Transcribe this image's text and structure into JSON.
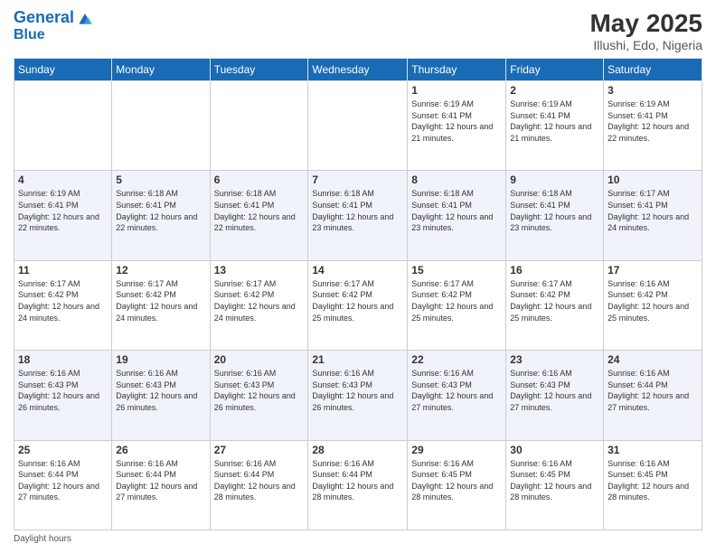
{
  "logo": {
    "line1": "General",
    "line2": "Blue"
  },
  "title": "May 2025",
  "subtitle": "Illushi, Edo, Nigeria",
  "days_of_week": [
    "Sunday",
    "Monday",
    "Tuesday",
    "Wednesday",
    "Thursday",
    "Friday",
    "Saturday"
  ],
  "footer_label": "Daylight hours",
  "weeks": [
    [
      {
        "num": "",
        "info": ""
      },
      {
        "num": "",
        "info": ""
      },
      {
        "num": "",
        "info": ""
      },
      {
        "num": "",
        "info": ""
      },
      {
        "num": "1",
        "info": "Sunrise: 6:19 AM\nSunset: 6:41 PM\nDaylight: 12 hours\nand 21 minutes."
      },
      {
        "num": "2",
        "info": "Sunrise: 6:19 AM\nSunset: 6:41 PM\nDaylight: 12 hours\nand 21 minutes."
      },
      {
        "num": "3",
        "info": "Sunrise: 6:19 AM\nSunset: 6:41 PM\nDaylight: 12 hours\nand 22 minutes."
      }
    ],
    [
      {
        "num": "4",
        "info": "Sunrise: 6:19 AM\nSunset: 6:41 PM\nDaylight: 12 hours\nand 22 minutes."
      },
      {
        "num": "5",
        "info": "Sunrise: 6:18 AM\nSunset: 6:41 PM\nDaylight: 12 hours\nand 22 minutes."
      },
      {
        "num": "6",
        "info": "Sunrise: 6:18 AM\nSunset: 6:41 PM\nDaylight: 12 hours\nand 22 minutes."
      },
      {
        "num": "7",
        "info": "Sunrise: 6:18 AM\nSunset: 6:41 PM\nDaylight: 12 hours\nand 23 minutes."
      },
      {
        "num": "8",
        "info": "Sunrise: 6:18 AM\nSunset: 6:41 PM\nDaylight: 12 hours\nand 23 minutes."
      },
      {
        "num": "9",
        "info": "Sunrise: 6:18 AM\nSunset: 6:41 PM\nDaylight: 12 hours\nand 23 minutes."
      },
      {
        "num": "10",
        "info": "Sunrise: 6:17 AM\nSunset: 6:41 PM\nDaylight: 12 hours\nand 24 minutes."
      }
    ],
    [
      {
        "num": "11",
        "info": "Sunrise: 6:17 AM\nSunset: 6:42 PM\nDaylight: 12 hours\nand 24 minutes."
      },
      {
        "num": "12",
        "info": "Sunrise: 6:17 AM\nSunset: 6:42 PM\nDaylight: 12 hours\nand 24 minutes."
      },
      {
        "num": "13",
        "info": "Sunrise: 6:17 AM\nSunset: 6:42 PM\nDaylight: 12 hours\nand 24 minutes."
      },
      {
        "num": "14",
        "info": "Sunrise: 6:17 AM\nSunset: 6:42 PM\nDaylight: 12 hours\nand 25 minutes."
      },
      {
        "num": "15",
        "info": "Sunrise: 6:17 AM\nSunset: 6:42 PM\nDaylight: 12 hours\nand 25 minutes."
      },
      {
        "num": "16",
        "info": "Sunrise: 6:17 AM\nSunset: 6:42 PM\nDaylight: 12 hours\nand 25 minutes."
      },
      {
        "num": "17",
        "info": "Sunrise: 6:16 AM\nSunset: 6:42 PM\nDaylight: 12 hours\nand 25 minutes."
      }
    ],
    [
      {
        "num": "18",
        "info": "Sunrise: 6:16 AM\nSunset: 6:43 PM\nDaylight: 12 hours\nand 26 minutes."
      },
      {
        "num": "19",
        "info": "Sunrise: 6:16 AM\nSunset: 6:43 PM\nDaylight: 12 hours\nand 26 minutes."
      },
      {
        "num": "20",
        "info": "Sunrise: 6:16 AM\nSunset: 6:43 PM\nDaylight: 12 hours\nand 26 minutes."
      },
      {
        "num": "21",
        "info": "Sunrise: 6:16 AM\nSunset: 6:43 PM\nDaylight: 12 hours\nand 26 minutes."
      },
      {
        "num": "22",
        "info": "Sunrise: 6:16 AM\nSunset: 6:43 PM\nDaylight: 12 hours\nand 27 minutes."
      },
      {
        "num": "23",
        "info": "Sunrise: 6:16 AM\nSunset: 6:43 PM\nDaylight: 12 hours\nand 27 minutes."
      },
      {
        "num": "24",
        "info": "Sunrise: 6:16 AM\nSunset: 6:44 PM\nDaylight: 12 hours\nand 27 minutes."
      }
    ],
    [
      {
        "num": "25",
        "info": "Sunrise: 6:16 AM\nSunset: 6:44 PM\nDaylight: 12 hours\nand 27 minutes."
      },
      {
        "num": "26",
        "info": "Sunrise: 6:16 AM\nSunset: 6:44 PM\nDaylight: 12 hours\nand 27 minutes."
      },
      {
        "num": "27",
        "info": "Sunrise: 6:16 AM\nSunset: 6:44 PM\nDaylight: 12 hours\nand 28 minutes."
      },
      {
        "num": "28",
        "info": "Sunrise: 6:16 AM\nSunset: 6:44 PM\nDaylight: 12 hours\nand 28 minutes."
      },
      {
        "num": "29",
        "info": "Sunrise: 6:16 AM\nSunset: 6:45 PM\nDaylight: 12 hours\nand 28 minutes."
      },
      {
        "num": "30",
        "info": "Sunrise: 6:16 AM\nSunset: 6:45 PM\nDaylight: 12 hours\nand 28 minutes."
      },
      {
        "num": "31",
        "info": "Sunrise: 6:16 AM\nSunset: 6:45 PM\nDaylight: 12 hours\nand 28 minutes."
      }
    ]
  ]
}
